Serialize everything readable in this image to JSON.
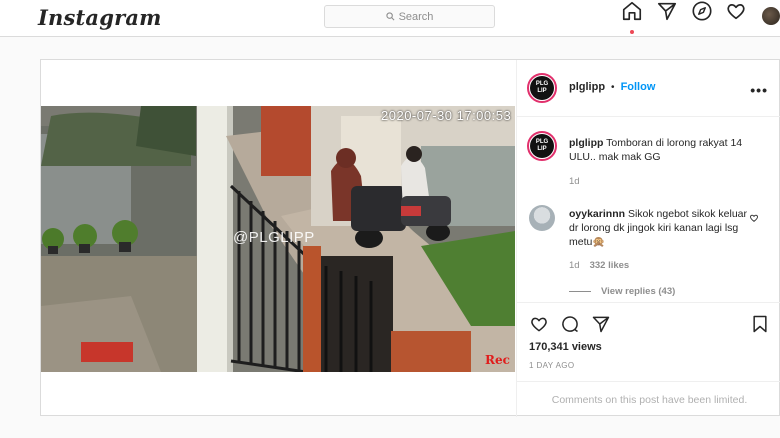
{
  "header": {
    "logo": "Instagram",
    "search_placeholder": "Search",
    "icons": [
      "home-icon",
      "direct-icon",
      "explore-icon",
      "activity-heart-icon",
      "profile-avatar"
    ]
  },
  "post": {
    "username": "plglipp",
    "separator": "•",
    "follow_label": "Follow",
    "more_label": "•••",
    "avatar_text": [
      "PLG",
      "LIP"
    ],
    "caption_user": "plglipp",
    "caption_text": "Tomboran di lorong rakyat 14 ULU.. mak mak GG",
    "caption_time": "1d",
    "video_overlay": {
      "timestamp": "2020-07-30 17:00:53",
      "watermark": "@PLGLIPP",
      "rec": "Rec"
    },
    "comment": {
      "user": "oyykarinnn",
      "text": "Sikok ngebot sikok keluar dr lorong dk jingok kiri kanan lagi lsg metu🙊",
      "time": "1d",
      "likes": "332 likes",
      "view_replies": "View replies (43)"
    },
    "views": "170,341 views",
    "ago": "1 DAY AGO",
    "comments_limited": "Comments on this post have been limited."
  },
  "colors": {
    "accent_blue": "#0095f6",
    "notification_red": "#ed4956",
    "border": "#dbdbdb",
    "muted_text": "#8e8e8e"
  }
}
